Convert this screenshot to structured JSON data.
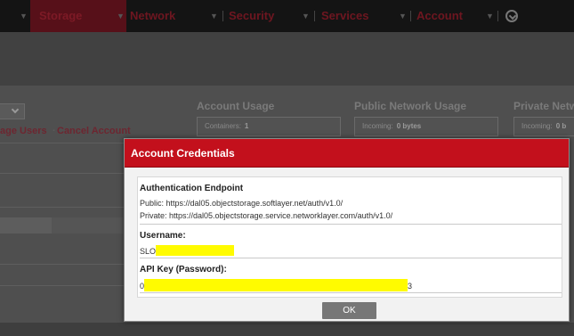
{
  "nav": {
    "items": [
      {
        "label": "Storage"
      },
      {
        "label": "Network"
      },
      {
        "label": "Security"
      },
      {
        "label": "Services"
      },
      {
        "label": "Account"
      }
    ]
  },
  "background": {
    "links": [
      "age Users",
      "Cancel Account"
    ],
    "account_usage": {
      "heading": "Account Usage",
      "label": "Containers:",
      "value": "1"
    },
    "public_network": {
      "heading": "Public Network Usage",
      "label": "Incoming:",
      "value": "0 bytes"
    },
    "private_network": {
      "heading": "Private Networ",
      "label": "Incoming:",
      "value": "0 b"
    }
  },
  "dialog": {
    "title": "Account Credentials",
    "auth": {
      "heading": "Authentication Endpoint",
      "public": "Public: https://dal05.objectstorage.softlayer.net/auth/v1.0/",
      "private": "Private: https://dal05.objectstorage.service.networklayer.com/auth/v1.0/"
    },
    "username": {
      "heading": "Username:",
      "value_prefix": "SLO"
    },
    "api_key": {
      "heading": "API Key (Password):",
      "value_prefix": "0",
      "value_suffix": "3"
    },
    "ok_label": "OK"
  },
  "colors": {
    "accent": "#c3101c",
    "redaction": "#fffb00"
  }
}
